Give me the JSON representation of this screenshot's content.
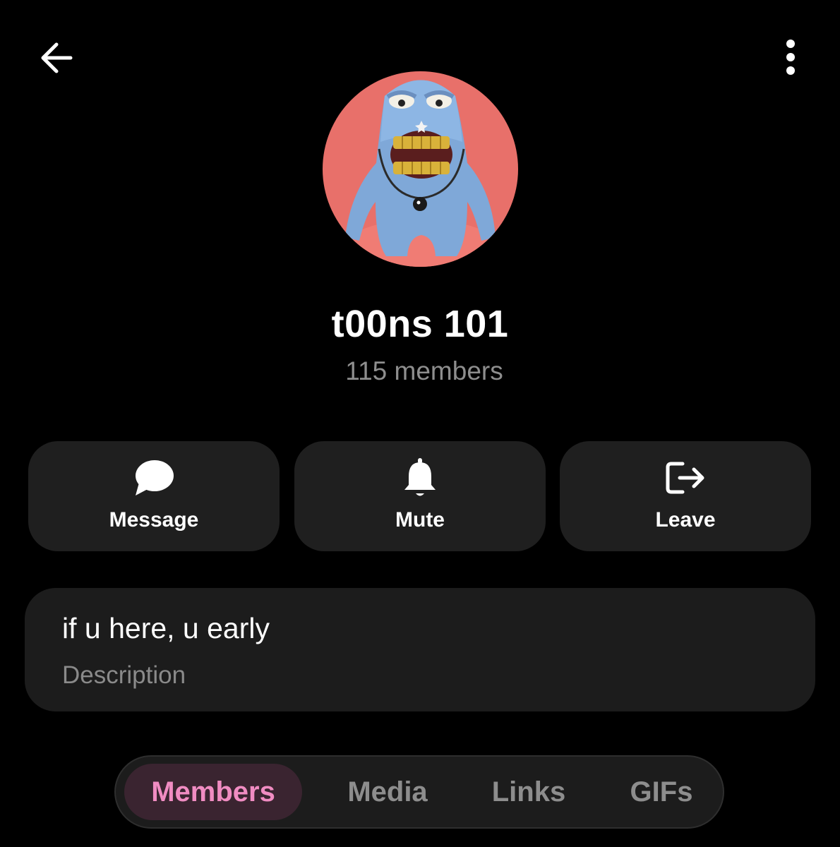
{
  "header": {
    "back_icon": "arrow-left-icon",
    "more_icon": "more-vertical-icon"
  },
  "group": {
    "name": "t00ns 101",
    "members": "115 members",
    "avatar_bg_color": "#e8706a"
  },
  "actions": [
    {
      "label": "Message",
      "icon": "chat-bubble-icon"
    },
    {
      "label": "Mute",
      "icon": "bell-icon"
    },
    {
      "label": "Leave",
      "icon": "exit-icon"
    }
  ],
  "description": {
    "text": "if u here, u early",
    "label": "Description"
  },
  "tabs": [
    {
      "label": "Members",
      "active": true
    },
    {
      "label": "Media",
      "active": false
    },
    {
      "label": "Links",
      "active": false
    },
    {
      "label": "GIFs",
      "active": false
    }
  ],
  "colors": {
    "accent": "#f08cc2",
    "card_bg": "#1f1f1f",
    "muted_text": "#8e8e8e"
  }
}
